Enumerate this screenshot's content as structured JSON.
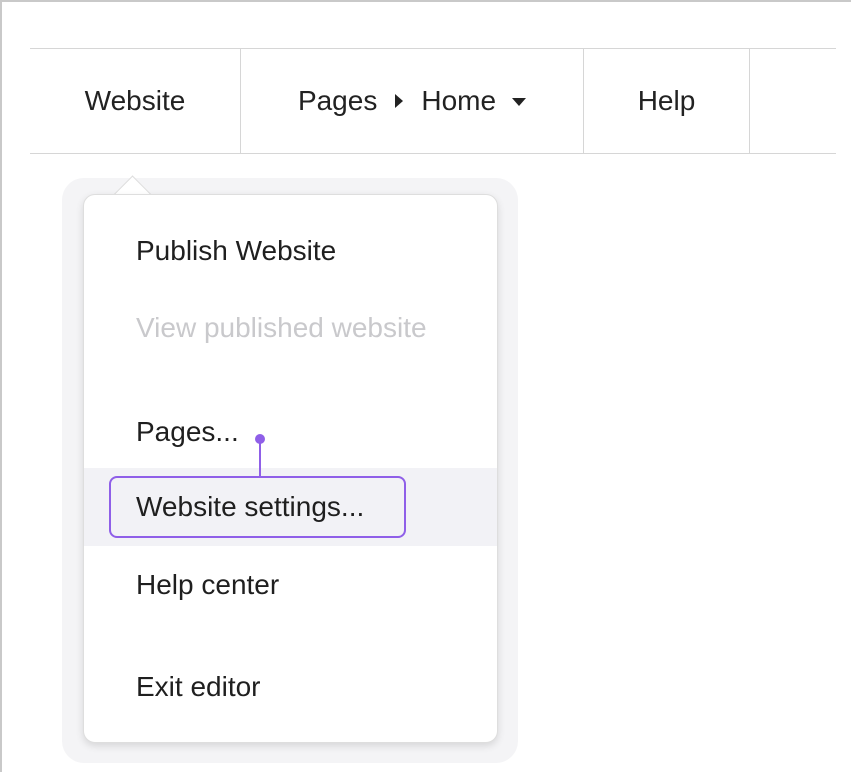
{
  "menubar": {
    "website_label": "Website",
    "pages_label": "Pages",
    "home_label": "Home",
    "help_label": "Help"
  },
  "dropdown": {
    "items": [
      {
        "label": "Publish Website",
        "enabled": true
      },
      {
        "label": "View published website",
        "enabled": false
      },
      {
        "label": "Pages...",
        "enabled": true
      },
      {
        "label": "Website settings...",
        "enabled": true,
        "highlighted": true
      },
      {
        "label": "Help center",
        "enabled": true
      },
      {
        "label": "Exit editor",
        "enabled": true
      }
    ]
  },
  "colors": {
    "highlight": "#8f5fe8",
    "disabled_text": "#c9c9cc",
    "hover_bg": "#f2f2f6"
  }
}
